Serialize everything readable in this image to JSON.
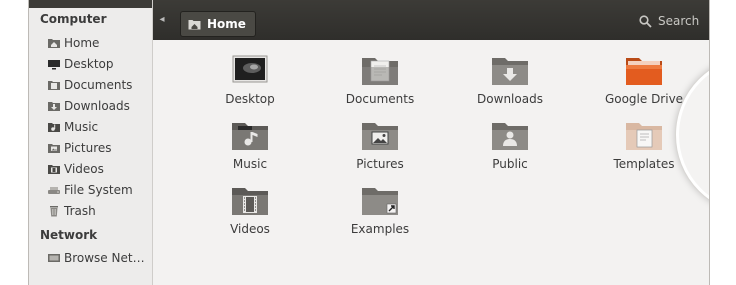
{
  "sidebar": {
    "sections": [
      {
        "title": "Computer",
        "items": [
          {
            "label": "Home",
            "icon": "home-folder-icon"
          },
          {
            "label": "Desktop",
            "icon": "desktop-icon"
          },
          {
            "label": "Documents",
            "icon": "documents-icon"
          },
          {
            "label": "Downloads",
            "icon": "downloads-icon"
          },
          {
            "label": "Music",
            "icon": "music-icon"
          },
          {
            "label": "Pictures",
            "icon": "pictures-icon"
          },
          {
            "label": "Videos",
            "icon": "videos-icon"
          },
          {
            "label": "File System",
            "icon": "filesystem-icon"
          },
          {
            "label": "Trash",
            "icon": "trash-icon"
          }
        ]
      },
      {
        "title": "Network",
        "items": [
          {
            "label": "Browse Net…",
            "icon": "network-icon"
          }
        ]
      }
    ]
  },
  "toolbar": {
    "breadcrumb": {
      "label": "Home",
      "icon": "home-folder-icon"
    },
    "search_label": "Search"
  },
  "files": [
    {
      "label": "Desktop",
      "icon": "desktop-folder-icon"
    },
    {
      "label": "Documents",
      "icon": "documents-folder-icon"
    },
    {
      "label": "Downloads",
      "icon": "downloads-folder-icon"
    },
    {
      "label": "Google Drive",
      "icon": "google-drive-folder-icon",
      "highlighted": true
    },
    {
      "label": "Music",
      "icon": "music-folder-icon"
    },
    {
      "label": "Pictures",
      "icon": "pictures-folder-icon"
    },
    {
      "label": "Public",
      "icon": "public-folder-icon"
    },
    {
      "label": "Templates",
      "icon": "templates-folder-icon"
    },
    {
      "label": "Videos",
      "icon": "videos-folder-icon"
    },
    {
      "label": "Examples",
      "icon": "examples-folder-icon"
    }
  ],
  "colors": {
    "toolbar": "#3c3b37",
    "folder_gray": "#7a7874",
    "google_drive_folder": "#e35c1f",
    "sidebar": "#edeceb"
  }
}
